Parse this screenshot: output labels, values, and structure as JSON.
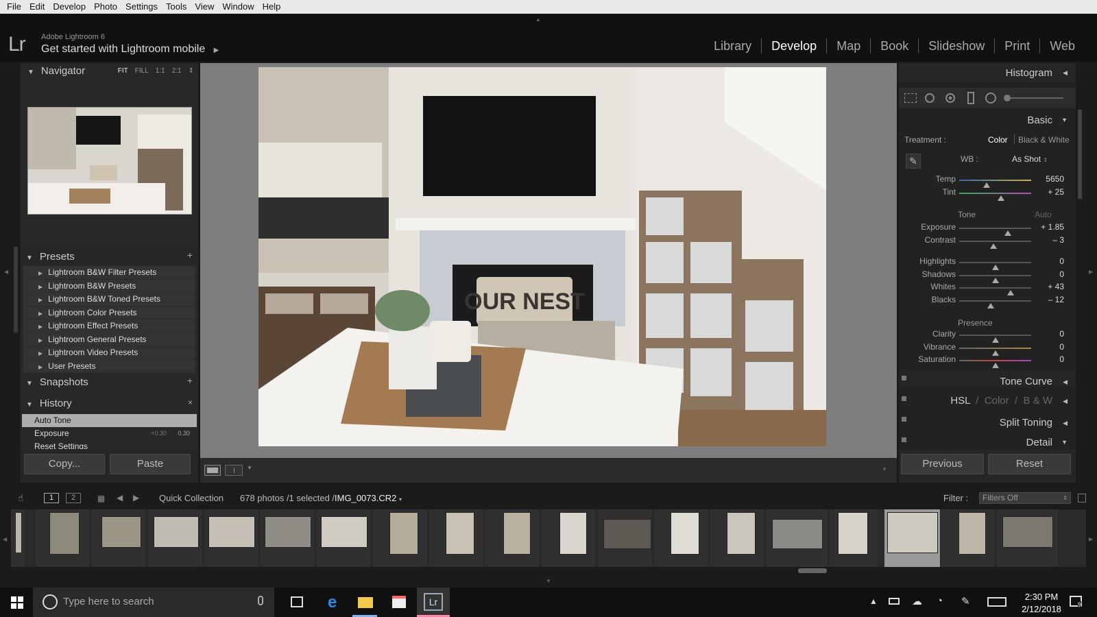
{
  "menubar": [
    "File",
    "Edit",
    "Develop",
    "Photo",
    "Settings",
    "Tools",
    "View",
    "Window",
    "Help"
  ],
  "identity": {
    "logo": "Lr",
    "app_name": "Adobe Lightroom 6",
    "subtitle": "Get started with Lightroom mobile",
    "subtitle_arrow": "▶"
  },
  "modules": [
    {
      "label": "Library",
      "active": false
    },
    {
      "label": "Develop",
      "active": true
    },
    {
      "label": "Map",
      "active": false
    },
    {
      "label": "Book",
      "active": false
    },
    {
      "label": "Slideshow",
      "active": false
    },
    {
      "label": "Print",
      "active": false
    },
    {
      "label": "Web",
      "active": false
    }
  ],
  "navigator": {
    "title": "Navigator",
    "zoom": [
      "FIT",
      "FILL",
      "1:1",
      "2:1"
    ]
  },
  "presets": {
    "title": "Presets",
    "items": [
      "Lightroom B&W Filter Presets",
      "Lightroom B&W Presets",
      "Lightroom B&W Toned Presets",
      "Lightroom Color Presets",
      "Lightroom Effect Presets",
      "Lightroom General Presets",
      "Lightroom Video Presets",
      "User Presets"
    ]
  },
  "snapshots": {
    "title": "Snapshots"
  },
  "history": {
    "title": "History",
    "items": [
      {
        "label": "Auto Tone",
        "delta": "",
        "value": "",
        "selected": true
      },
      {
        "label": "Exposure",
        "delta": "+0.30",
        "value": "0.30",
        "selected": false
      },
      {
        "label": "Reset Settings",
        "delta": "",
        "value": "",
        "selected": false
      }
    ]
  },
  "left_buttons": {
    "copy": "Copy...",
    "paste": "Paste"
  },
  "photo": {
    "pillow_text": "OUR NEST"
  },
  "right": {
    "histogram_title": "Histogram",
    "basic_title": "Basic",
    "treatment_label": "Treatment :",
    "treatment_color": "Color",
    "treatment_bw": "Black & White",
    "wb_label": "WB :",
    "wb_value": "As Shot",
    "tone_label": "Tone",
    "auto_label": "Auto",
    "presence_label": "Presence",
    "sliders": [
      {
        "label": "Temp",
        "value": "5650",
        "pos": 0.38
      },
      {
        "label": "Tint",
        "value": "+ 25",
        "pos": 0.58
      },
      {
        "label": "Exposure",
        "value": "+ 1.85",
        "pos": 0.68
      },
      {
        "label": "Contrast",
        "value": "– 3",
        "pos": 0.48
      },
      {
        "label": "Highlights",
        "value": "0",
        "pos": 0.5
      },
      {
        "label": "Shadows",
        "value": "0",
        "pos": 0.5
      },
      {
        "label": "Whites",
        "value": "+ 43",
        "pos": 0.71
      },
      {
        "label": "Blacks",
        "value": "– 12",
        "pos": 0.44
      },
      {
        "label": "Clarity",
        "value": "0",
        "pos": 0.5
      },
      {
        "label": "Vibrance",
        "value": "0",
        "pos": 0.5
      },
      {
        "label": "Saturation",
        "value": "0",
        "pos": 0.5
      }
    ],
    "tone_curve": "Tone Curve",
    "hsl": "HSL",
    "hsl_color": "Color",
    "hsl_bw": "B & W",
    "split_toning": "Split Toning",
    "detail": "Detail",
    "previous": "Previous",
    "reset": "Reset"
  },
  "filmbar": {
    "page1": "1",
    "page2": "2",
    "source": "Quick Collection",
    "count": "678 photos /1 selected /",
    "filename": "IMG_0073.CR2",
    "filter_label": "Filter :",
    "filter_value": "Filters Off"
  },
  "taskbar": {
    "search_placeholder": "Type here to search",
    "time": "2:30 PM",
    "date": "2/12/2018",
    "notif_count": "9"
  }
}
